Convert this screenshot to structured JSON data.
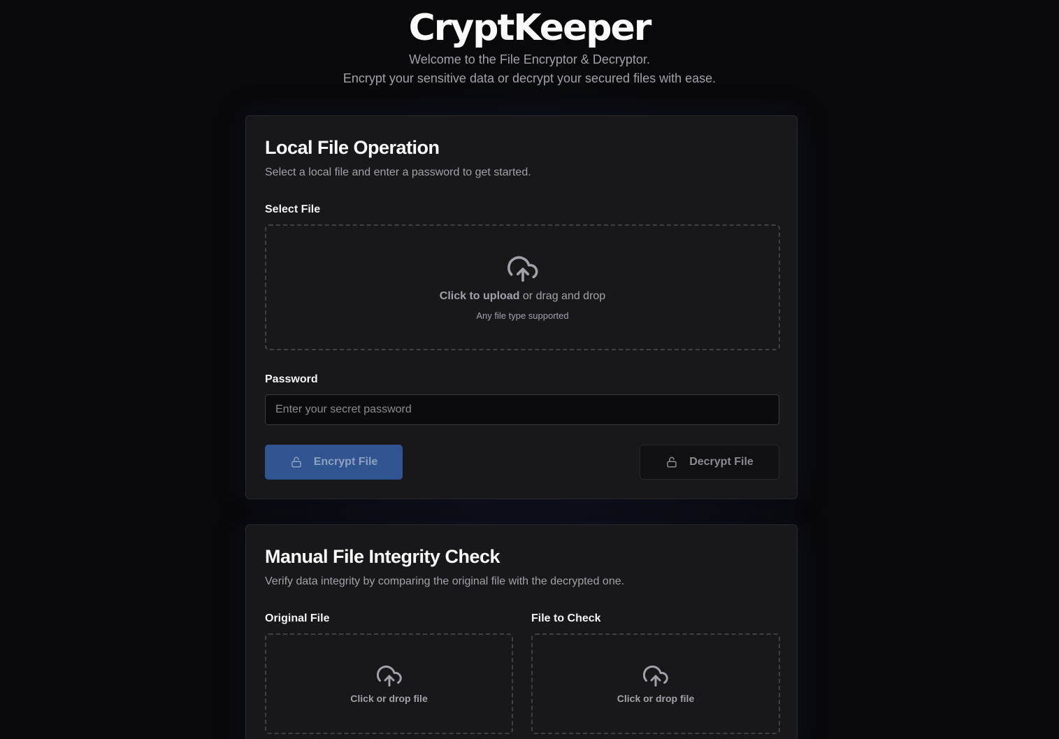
{
  "header": {
    "title": "CryptKeeper",
    "subtitle_line1": "Welcome to the File Encryptor & Decryptor.",
    "subtitle_line2": "Encrypt your sensitive data or decrypt your secured files with ease."
  },
  "local_operation": {
    "title": "Local File Operation",
    "description": "Select a local file and enter a password to get started.",
    "select_file_label": "Select File",
    "dropzone": {
      "icon": "cloud-upload-icon",
      "click_text": "Click to upload",
      "rest_text": " or drag and drop",
      "sub_text": "Any file type supported"
    },
    "password_label": "Password",
    "password_placeholder": "Enter your secret password",
    "password_value": "",
    "encrypt_label": "Encrypt File",
    "decrypt_label": "Decrypt File"
  },
  "integrity_check": {
    "title": "Manual File Integrity Check",
    "description": "Verify data integrity by comparing the original file with the decrypted one.",
    "original_label": "Original File",
    "check_label": "File to Check",
    "original_drop_text": "Click or drop file",
    "check_drop_text": "Click or drop file"
  },
  "colors": {
    "background": "#09090b",
    "card": "#18181b",
    "primary_button": "#2f548f"
  }
}
